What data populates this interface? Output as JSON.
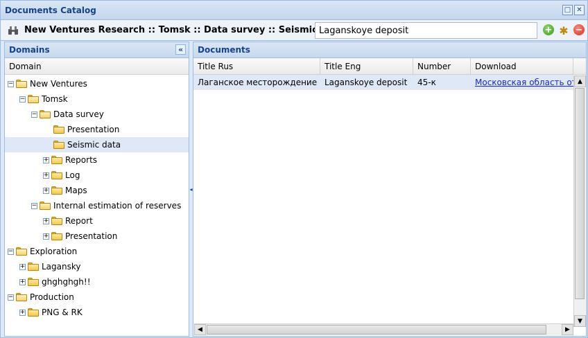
{
  "window": {
    "title": "Documents Catalog",
    "tools": {
      "maximize": "□",
      "close": "✕"
    }
  },
  "toolbar": {
    "path_label": "New Ventures Research :: Tomsk :: Data survey :: Seismic data",
    "search_value": "Laganskoye deposit",
    "icons": [
      "binoculars-icon",
      "add-icon",
      "gear-icon",
      "delete-icon"
    ]
  },
  "domains": {
    "header": "Domains",
    "column": "Domain",
    "collapse_symbol": "«",
    "tree": [
      {
        "label": "New Ventures",
        "level": 0,
        "state": "open"
      },
      {
        "label": "Tomsk",
        "level": 1,
        "state": "open"
      },
      {
        "label": "Data survey",
        "level": 2,
        "state": "open"
      },
      {
        "label": "Presentation",
        "level": 3,
        "state": "leaf"
      },
      {
        "label": "Seismic data",
        "level": 3,
        "state": "leaf",
        "selected": true
      },
      {
        "label": "Reports",
        "level": 3,
        "state": "closed"
      },
      {
        "label": "Log",
        "level": 3,
        "state": "closed"
      },
      {
        "label": "Maps",
        "level": 3,
        "state": "closed"
      },
      {
        "label": "Internal estimation of reserves",
        "level": 2,
        "state": "open"
      },
      {
        "label": "Report",
        "level": 3,
        "state": "closed"
      },
      {
        "label": "Presentation",
        "level": 3,
        "state": "closed"
      },
      {
        "label": "Exploration",
        "level": 0,
        "state": "open"
      },
      {
        "label": "Lagansky",
        "level": 1,
        "state": "closed"
      },
      {
        "label": "ghghghgh!!",
        "level": 1,
        "state": "closed"
      },
      {
        "label": "Production",
        "level": 0,
        "state": "open"
      },
      {
        "label": "PNG & RK",
        "level": 1,
        "state": "closed"
      }
    ]
  },
  "documents": {
    "header": "Documents",
    "columns": [
      "Title Rus",
      "Title Eng",
      "Number",
      "Download"
    ],
    "rows": [
      [
        "Лаганское месторождение",
        "Laganskoye deposit",
        "45-к",
        "Московская область от"
      ]
    ]
  },
  "colors": {
    "header_text": "#15428b",
    "border": "#99bbe8",
    "selection": "#dfe8f6",
    "link": "#1c29c4"
  }
}
